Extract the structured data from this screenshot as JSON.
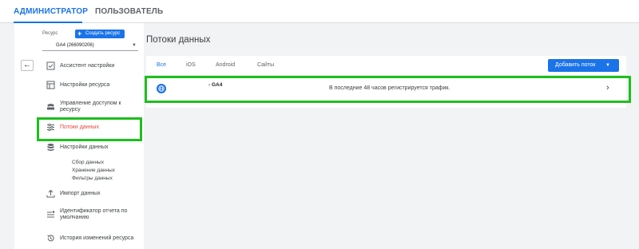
{
  "top_tabs": {
    "admin": "АДМИНИСТРАТОР",
    "user": "ПОЛЬЗОВАТЕЛЬ"
  },
  "resource": {
    "label": "Ресурс",
    "create_button": "Создать ресурс",
    "selected": "GA4 (266090206)"
  },
  "nav": {
    "items": [
      {
        "label": "Ассистент настройки",
        "icon": "checkbox-icon"
      },
      {
        "label": "Настройки ресурса",
        "icon": "property-settings-icon"
      },
      {
        "label": "Управление доступом к ресурсу",
        "icon": "people-icon"
      },
      {
        "label": "Потоки данных",
        "icon": "data-streams-icon"
      },
      {
        "label": "Настройки данных",
        "icon": "database-icon"
      },
      {
        "label": "Импорт данных",
        "icon": "upload-icon"
      },
      {
        "label": "Идентификатор отчета по умолчанию",
        "icon": "report-id-icon"
      },
      {
        "label": "История изменений ресурса",
        "icon": "history-icon"
      }
    ],
    "sub_items": [
      "Сбор данных",
      "Хранение данных",
      "Фильтры данных"
    ]
  },
  "main": {
    "title": "Потоки данных",
    "tabs": [
      "Все",
      "iOS",
      "Android",
      "Сайты"
    ],
    "add_button": "Добавить поток",
    "stream": {
      "name": "- GA4",
      "status": "В последние 48 часов регистрируется трафик."
    }
  },
  "colors": {
    "accent": "#1a73e8",
    "active_nav": "#e8453c",
    "highlight": "#1dbf1d"
  }
}
